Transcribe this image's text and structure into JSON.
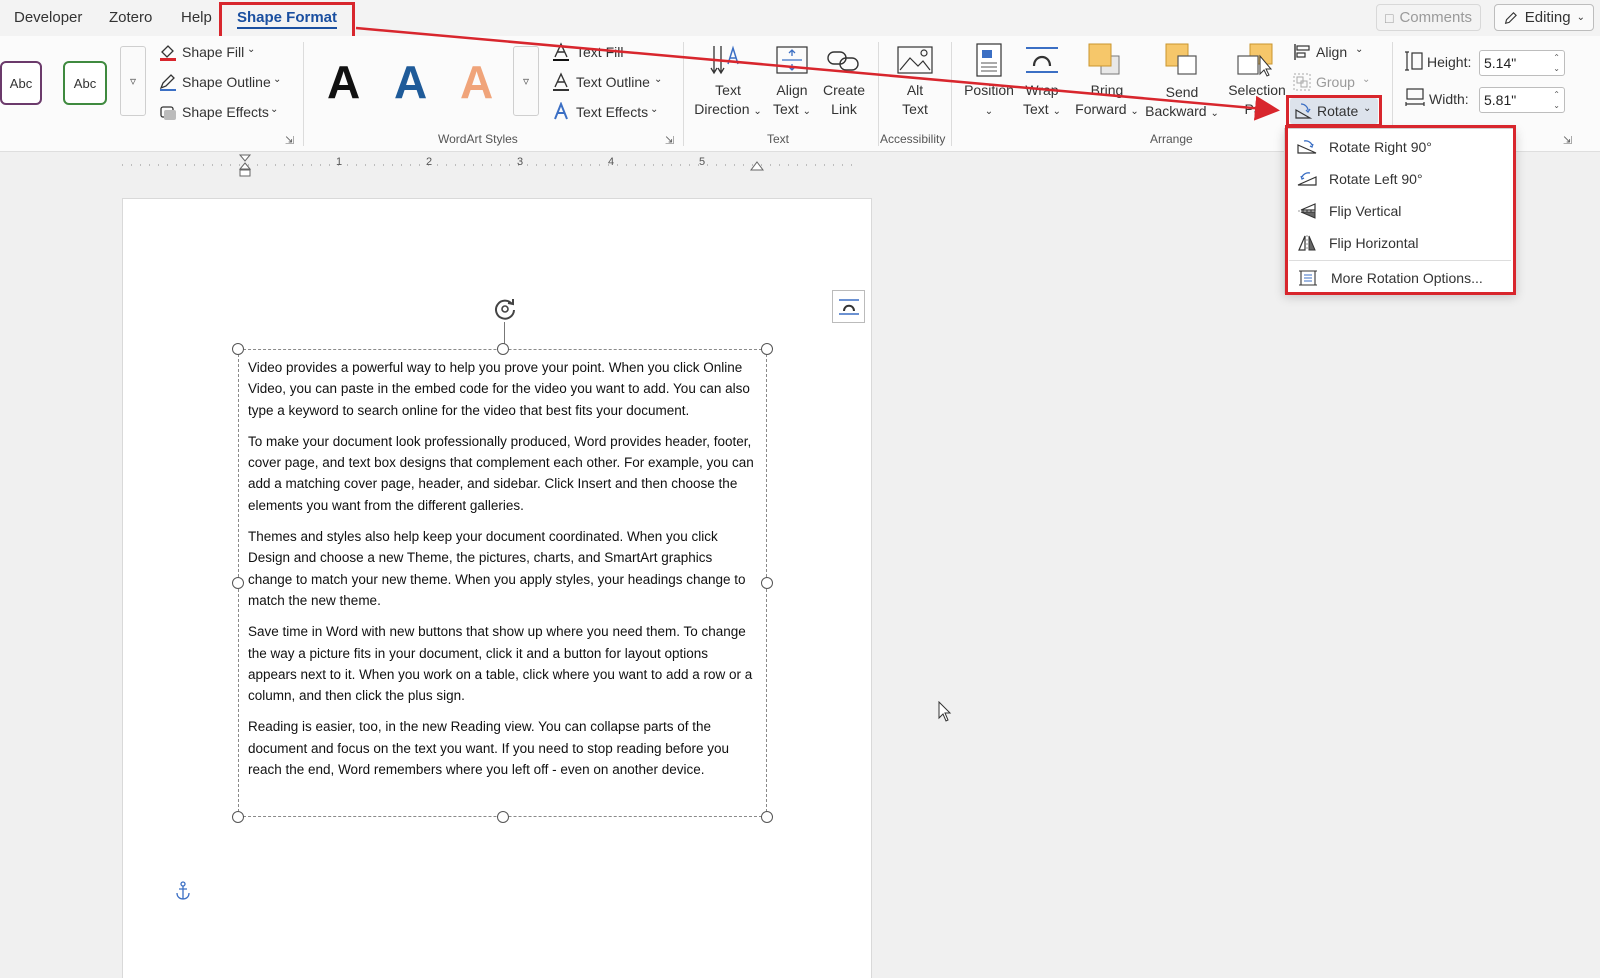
{
  "tabs": [
    {
      "label": "Developer"
    },
    {
      "label": "Zotero"
    },
    {
      "label": "Help"
    },
    {
      "label": "Shape Format"
    }
  ],
  "top_right": {
    "comments_label": "Comments",
    "editing_label": "Editing"
  },
  "shape_styles": {
    "sample1": "Abc",
    "sample2": "Abc"
  },
  "shape_cmds": {
    "fill": "Shape Fill",
    "outline": "Shape Outline",
    "effects": "Shape Effects"
  },
  "wordart": {
    "letter": "A",
    "text_fill": "Text Fill",
    "text_outline": "Text Outline",
    "text_effects": "Text Effects",
    "group_label": "WordArt Styles"
  },
  "text_group": {
    "direction_l1": "Text",
    "direction_l2": "Direction",
    "align_l1": "Align",
    "align_l2": "Text",
    "link_l1": "Create",
    "link_l2": "Link",
    "group_label": "Text"
  },
  "accessibility": {
    "alt_l1": "Alt",
    "alt_l2": "Text",
    "group_label": "Accessibility"
  },
  "arrange": {
    "position": "Position",
    "wrap_l1": "Wrap",
    "wrap_l2": "Text",
    "bring_l1": "Bring",
    "bring_l2": "Forward",
    "send_l1": "Send",
    "send_l2": "Backward",
    "selection_l1": "Selection",
    "selection_l2": "Pan",
    "align": "Align",
    "group": "Group",
    "rotate": "Rotate",
    "group_label": "Arrange"
  },
  "size": {
    "height_label": "Height:",
    "height_value": "5.14\"",
    "width_label": "Width:",
    "width_value": "5.81\""
  },
  "ruler": {
    "marks": [
      "1",
      "2",
      "3",
      "4",
      "5"
    ]
  },
  "rotate_menu": [
    {
      "label": "Rotate Right 90°",
      "icon": "rotate-right-icon"
    },
    {
      "label": "Rotate Left 90°",
      "icon": "rotate-left-icon"
    },
    {
      "label": "Flip Vertical",
      "icon": "flip-vertical-icon"
    },
    {
      "label": "Flip Horizontal",
      "icon": "flip-horizontal-icon"
    },
    {
      "label": "More Rotation Options...",
      "icon": "more-rotation-icon"
    }
  ],
  "document": {
    "paragraphs": [
      "Video provides a powerful way to help you prove your point. When you click Online Video, you can paste in the embed code for the video you want to add. You can also type a keyword to search online for the video that best fits your document.",
      "To make your document look professionally produced, Word provides header, footer, cover page, and text box designs that complement each other. For example, you can add a matching cover page, header, and sidebar. Click Insert and then choose the elements you want from the different galleries.",
      "Themes and styles also help keep your document coordinated. When you click Design and choose a new Theme, the pictures, charts, and SmartArt graphics change to match your new theme. When you apply styles, your headings change to match the new theme.",
      "Save time in Word with new buttons that show up where you need them. To change the way a picture fits in your document, click it and a button for layout options appears next to it. When you work on a table, click where you want to add a row or a column, and then click the plus sign.",
      "Reading is easier, too, in the new Reading view. You can collapse parts of the document and focus on the text you want. If you need to stop reading before you reach the end, Word remembers where you left off - even on another device."
    ]
  },
  "colors": {
    "annotation_red": "#d8262d",
    "accent_blue": "#1a4fa0",
    "wordart_blue": "#1f5b99",
    "wordart_orange": "#f0a47a",
    "icon_yellow": "#f6c76a"
  }
}
